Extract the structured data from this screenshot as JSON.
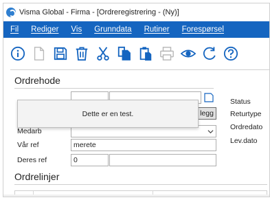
{
  "window": {
    "title": "Visma Global - Firma - [Ordreregistrering - (Ny)]"
  },
  "colors": {
    "menubar": "#1565c0",
    "icon_blue": "#1565c0"
  },
  "menu": [
    {
      "label": "Fil"
    },
    {
      "label": "Rediger"
    },
    {
      "label": "Vis"
    },
    {
      "label": "Grunndata"
    },
    {
      "label": "Rutiner"
    },
    {
      "label": "Forespørsel"
    }
  ],
  "toolbar": [
    {
      "icon": "info-icon"
    },
    {
      "icon": "new-document-icon"
    },
    {
      "icon": "save-icon"
    },
    {
      "icon": "delete-icon"
    },
    {
      "icon": "cut-icon"
    },
    {
      "icon": "copy-icon"
    },
    {
      "icon": "paste-icon"
    },
    {
      "icon": "print-icon"
    },
    {
      "icon": "preview-icon"
    },
    {
      "icon": "refresh-icon"
    },
    {
      "icon": "help-icon"
    }
  ],
  "ordrehode": {
    "title": "Ordrehode",
    "button_label": "legg",
    "medarb": {
      "label": "Medarb",
      "value": ""
    },
    "vaar_ref": {
      "label": "Vår ref",
      "value": "merete"
    },
    "deres_ref": {
      "label": "Deres ref",
      "value": "0",
      "value2": ""
    },
    "status": {
      "label": "Status"
    },
    "returtype": {
      "label": "Returtype"
    },
    "ordredato": {
      "label": "Ordredato"
    },
    "levdato": {
      "label": "Lev.dato"
    }
  },
  "popup": {
    "message": "Dette er en test."
  },
  "ordrelinjer": {
    "title": "Ordrelinjer"
  }
}
